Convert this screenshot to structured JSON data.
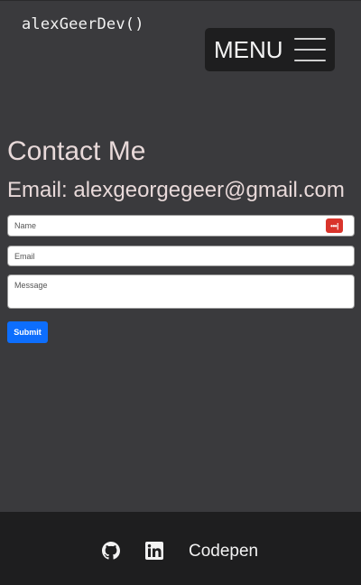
{
  "header": {
    "brand": "alexGeerDev()",
    "menu_label": "MENU"
  },
  "contact": {
    "title": "Contact Me",
    "email_line": "Email: alexgeorgegeer@gmail.com"
  },
  "form": {
    "name_placeholder": "Name",
    "email_placeholder": "Email",
    "message_placeholder": "Message",
    "submit_label": "Submit",
    "password_manager_icon_text": "•••|"
  },
  "footer": {
    "links": [
      {
        "icon": "github-icon",
        "label": "GitHub"
      },
      {
        "icon": "linkedin-icon",
        "label": "LinkedIn"
      }
    ],
    "codepen_label": "Codepen"
  },
  "colors": {
    "page_bg": "#3a3a3d",
    "dark_bg": "#1e1e1f",
    "heading_text": "#e8d9d9",
    "accent_blue": "#0d6efd",
    "password_icon_red": "#d9342b"
  }
}
